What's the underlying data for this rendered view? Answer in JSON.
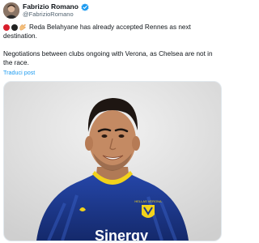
{
  "author": {
    "display_name": "Fabrizio Romano",
    "handle": "@FabrizioRomano",
    "verified_icon": "verified-badge-icon",
    "brand_color": "#1d9bf0"
  },
  "post": {
    "line1": "Reda Belahyane has already accepted Rennes as next",
    "line2": "destination.",
    "line3": "Negotiations between clubs ongoing with Verona, as Chelsea are not in",
    "line4": "the race.",
    "emojis": [
      "red-circle",
      "black-circle",
      "pinching-hand"
    ]
  },
  "translate_link": "Traduci post",
  "media": {
    "description_icon": "player-photo",
    "jersey_text": "Sinergy",
    "club_text": "HELLAS VERONA",
    "jersey_color": "#1c3a8f",
    "accent_color": "#f2d21b"
  }
}
